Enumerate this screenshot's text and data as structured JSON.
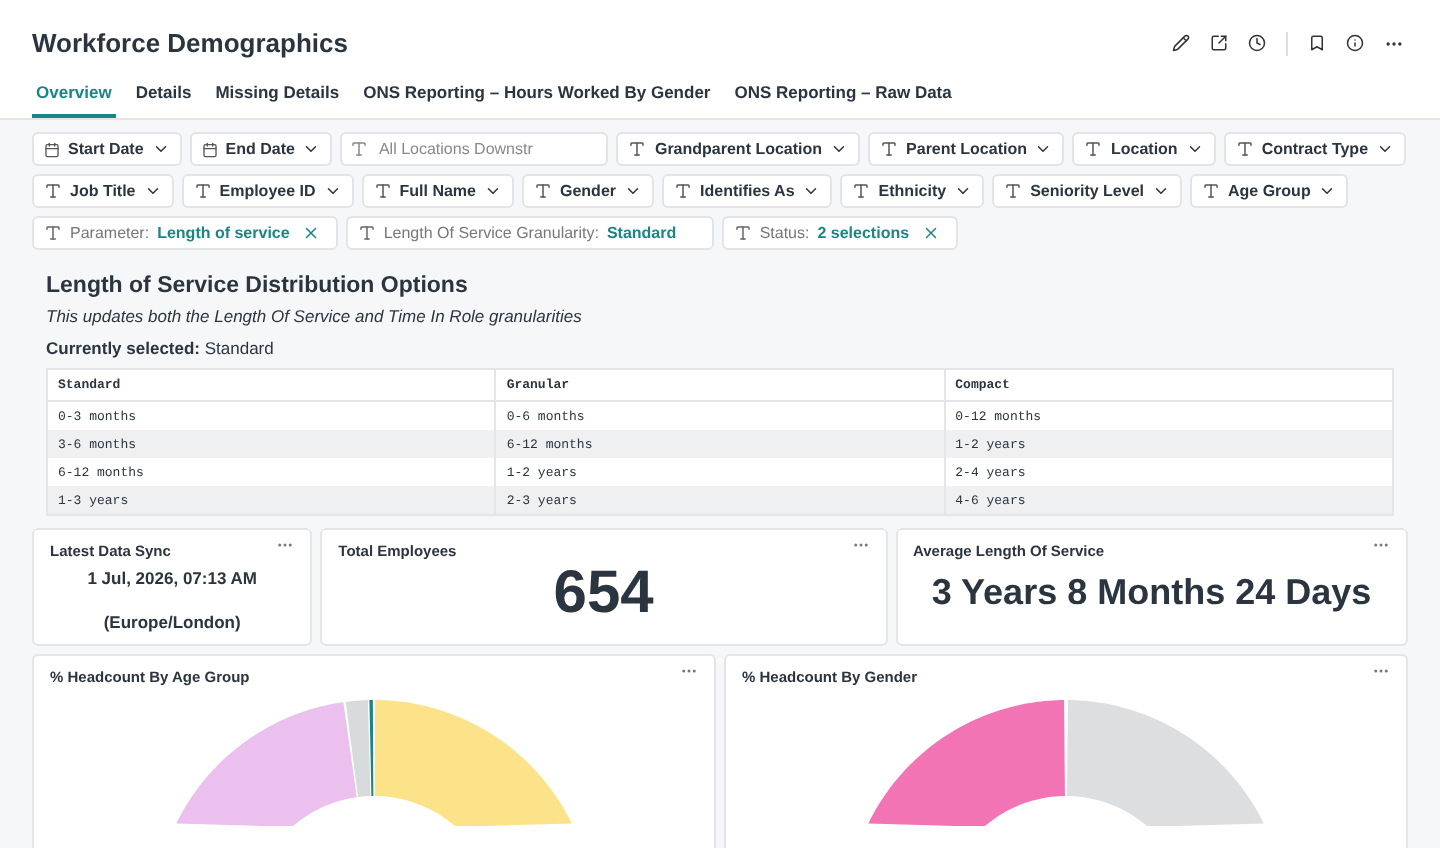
{
  "title": "Workforce Demographics",
  "tabs": [
    {
      "label": "Overview",
      "selected": true
    },
    {
      "label": "Details",
      "selected": false
    },
    {
      "label": "Missing Details",
      "selected": false
    },
    {
      "label": "ONS Reporting – Hours Worked By Gender",
      "selected": false
    },
    {
      "label": "ONS Reporting – Raw Data",
      "selected": false
    }
  ],
  "filter_rows": [
    [
      {
        "kind": "date",
        "label": "Start Date"
      },
      {
        "kind": "date",
        "label": "End Date"
      },
      {
        "kind": "input",
        "placeholder": "All Locations Downstr"
      },
      {
        "kind": "text",
        "label": "Grandparent Location"
      },
      {
        "kind": "text",
        "label": "Parent Location"
      },
      {
        "kind": "text",
        "label": "Location"
      },
      {
        "kind": "text",
        "label": "Contract Type"
      }
    ],
    [
      {
        "kind": "text",
        "label": "Job Title"
      },
      {
        "kind": "text",
        "label": "Employee ID"
      },
      {
        "kind": "text",
        "label": "Full Name"
      },
      {
        "kind": "text",
        "label": "Gender"
      },
      {
        "kind": "text",
        "label": "Identifies As"
      },
      {
        "kind": "text",
        "label": "Ethnicity"
      },
      {
        "kind": "text",
        "label": "Seniority Level"
      },
      {
        "kind": "text",
        "label": "Age Group"
      }
    ],
    [
      {
        "kind": "param",
        "label": "Parameter:",
        "value": "Length of service",
        "clearable": true
      },
      {
        "kind": "param",
        "label": "Length Of Service Granularity:",
        "value": "Standard",
        "clearable": false
      },
      {
        "kind": "param",
        "label": "Status:",
        "value": "2 selections",
        "clearable": true
      }
    ]
  ],
  "section": {
    "heading": "Length of Service Distribution Options",
    "subtitle": "This updates both the Length Of Service and Time In Role granularities",
    "current": "**Currently selected:** Standard",
    "table": {
      "columns": [
        "Standard",
        "Granular",
        "Compact"
      ],
      "rows": [
        [
          "0-3 months",
          "0-6 months",
          "0-12 months"
        ],
        [
          "3-6 months",
          "6-12 months",
          "1-2 years"
        ],
        [
          "6-12 months",
          "1-2 years",
          "2-4 years"
        ],
        [
          "1-3 years",
          "2-3 years",
          "4-6 years"
        ]
      ]
    }
  },
  "kpis": [
    {
      "kind": "sync",
      "title": "Latest Data Sync",
      "lines": [
        "1 Jul, 2026, 07:13 AM",
        "(Europe/London)"
      ]
    },
    {
      "kind": "big",
      "title": "Total Employees",
      "value": "654"
    },
    {
      "kind": "medium",
      "title": "Average Length Of Service",
      "value": "3 Years 8 Months 24 Days"
    }
  ],
  "charts": [
    {
      "kind": "age",
      "title": "% Headcount By Age Group"
    },
    {
      "kind": "gender",
      "title": "% Headcount By Gender"
    }
  ]
}
